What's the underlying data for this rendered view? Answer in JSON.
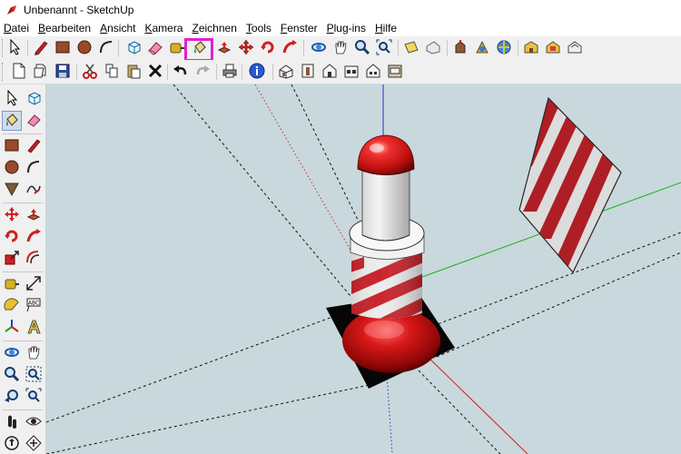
{
  "window": {
    "title": "Unbenannt - SketchUp",
    "app_icon": "sketchup-icon"
  },
  "menu": [
    {
      "first": "D",
      "rest": "atei"
    },
    {
      "first": "B",
      "rest": "earbeiten"
    },
    {
      "first": "A",
      "rest": "nsicht"
    },
    {
      "first": "K",
      "rest": "amera"
    },
    {
      "first": "Z",
      "rest": "eichnen"
    },
    {
      "first": "T",
      "rest": "ools"
    },
    {
      "first": "F",
      "rest": "enster"
    },
    {
      "first": "P",
      "rest": "lug-ins"
    },
    {
      "first": "H",
      "rest": "ilfe"
    }
  ],
  "toolbar1_icons": [
    "select-icon",
    "pencil-icon",
    "rectangle-icon",
    "circle-icon",
    "arc-icon",
    "make-component-icon",
    "eraser-icon",
    "tape-measure-icon",
    "paint-bucket-icon",
    "push-pull-icon",
    "move-icon",
    "rotate-icon",
    "follow-me-icon",
    "orbit-icon",
    "pan-icon",
    "zoom-icon",
    "zoom-extents-icon",
    "add-location-icon",
    "toggle-terrain-icon",
    "get-models-icon",
    "share-model-icon",
    "get-photo-texture-icon",
    "warehouse-icon",
    "extension-warehouse-icon"
  ],
  "toolbar2_icons": [
    "new-icon",
    "open-icon",
    "save-icon",
    "cut-icon",
    "copy-icon",
    "paste-icon",
    "erase-icon",
    "undo-icon",
    "redo-icon",
    "print-icon",
    "model-info-icon",
    "iso-view-icon",
    "top-view-icon",
    "front-view-icon",
    "right-view-icon",
    "back-view-icon",
    "left-view-icon"
  ],
  "left_icons": [
    "select-icon",
    "make-component-icon",
    "paint-bucket-icon",
    "eraser-icon",
    "rectangle-icon",
    "line-icon",
    "circle-icon",
    "arc-icon",
    "polygon-icon",
    "freehand-icon",
    "move-icon",
    "push-pull-icon",
    "rotate-icon",
    "follow-me-icon",
    "scale-icon",
    "offset-icon",
    "tape-measure-icon",
    "dimension-icon",
    "protractor-icon",
    "text-icon",
    "axes-icon",
    "3d-text-icon",
    "orbit-icon",
    "pan-icon",
    "zoom-icon",
    "zoom-window-icon",
    "previous-view-icon",
    "zoom-extents-icon",
    "walk-icon",
    "look-around-icon",
    "position-camera-icon",
    "section-plane-icon"
  ],
  "colors": {
    "viewport_bg": "#c9d8dc",
    "highlight": "#e020d0",
    "stripe_red": "#c8242c",
    "stripe_white": "#e8e8e8",
    "cap_red": "#e01818"
  }
}
